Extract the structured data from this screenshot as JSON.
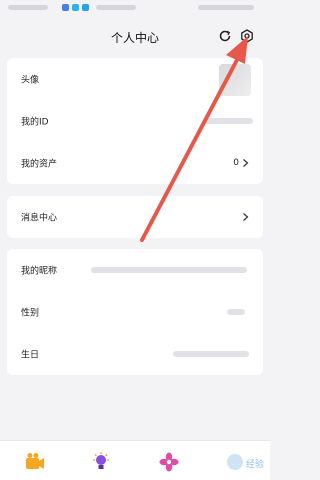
{
  "header": {
    "title": "个人中心"
  },
  "card1": {
    "rows": [
      {
        "label": "头像"
      },
      {
        "label": "我的ID"
      },
      {
        "label": "我的资产",
        "value": "0"
      }
    ]
  },
  "card2": {
    "rows": [
      {
        "label": "消息中心"
      }
    ]
  },
  "card3": {
    "rows": [
      {
        "label": "我的昵称"
      },
      {
        "label": "性别"
      },
      {
        "label": "生日"
      }
    ]
  },
  "colors": {
    "arrow": "#e8584a",
    "accent": "#f5a623"
  },
  "watermark": "经验"
}
